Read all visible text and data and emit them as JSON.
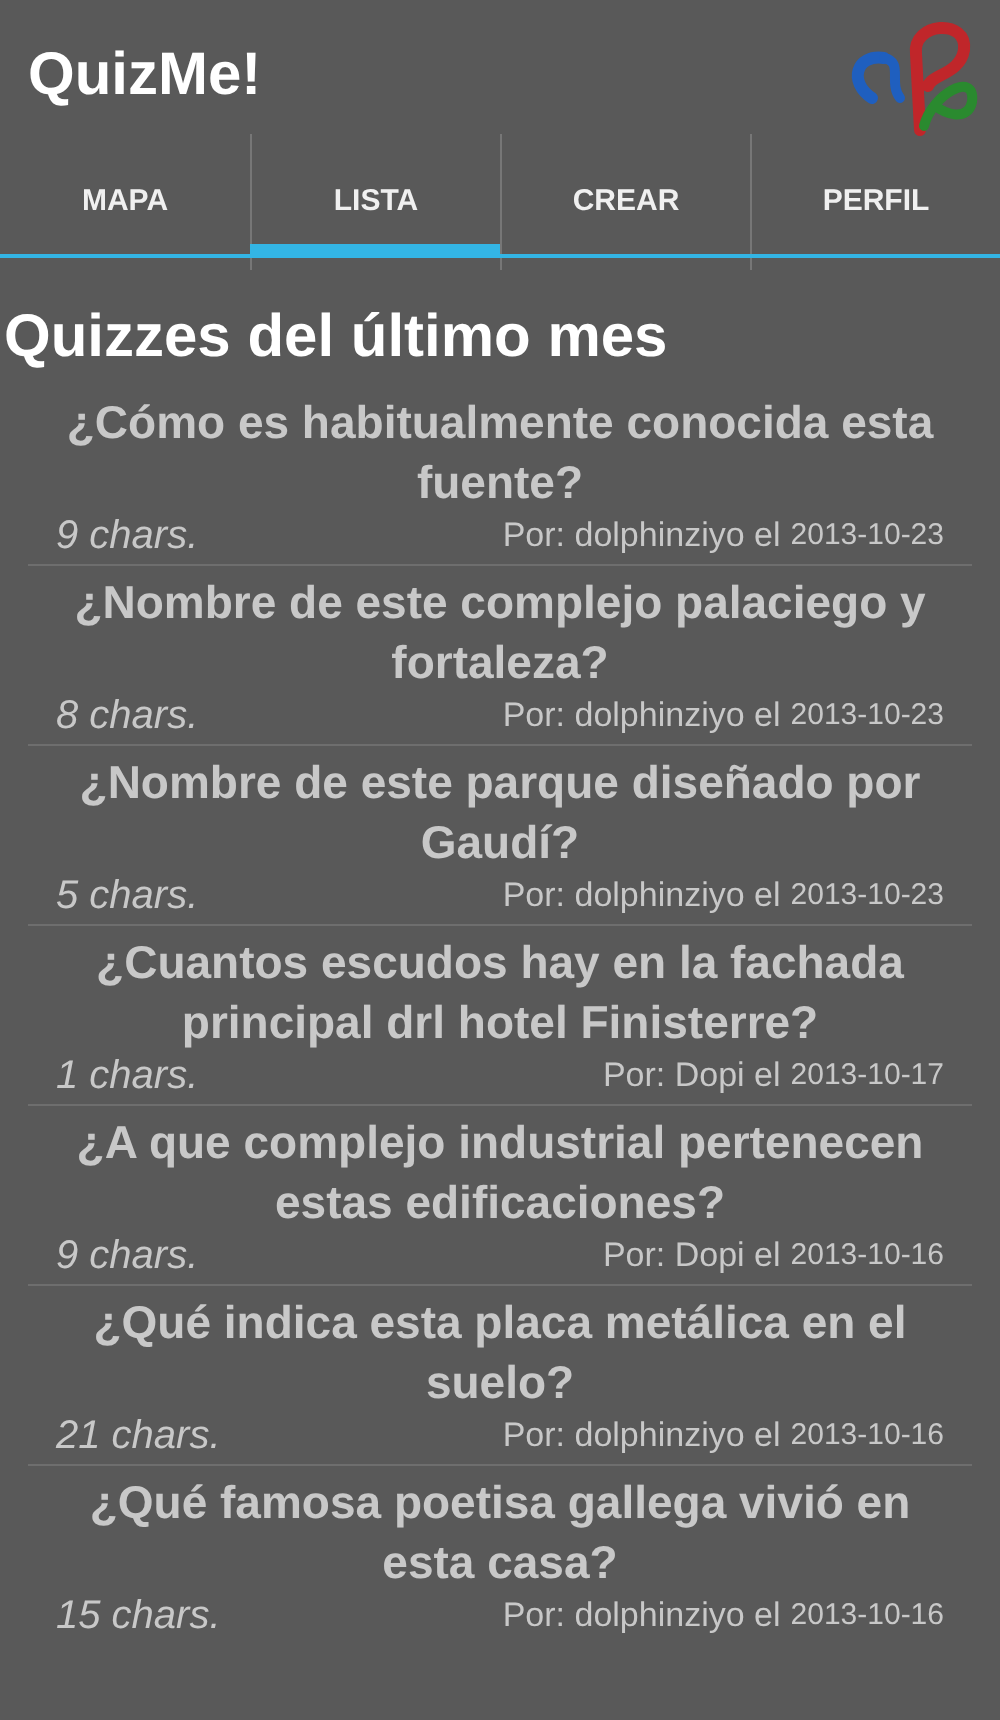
{
  "app_bar": {
    "title": "QuizMe!"
  },
  "tabs": [
    {
      "label": "MAPA",
      "selected": false
    },
    {
      "label": "LISTA",
      "selected": true
    },
    {
      "label": "CREAR",
      "selected": false
    },
    {
      "label": "PERFIL",
      "selected": false
    }
  ],
  "heading": "Quizzes del último mes",
  "quizzes": [
    {
      "question": "¿Cómo es habitualmente conocida esta fuente?",
      "chars": "9 chars.",
      "author": "Por: dolphinziyo el",
      "date": "2013-10-23"
    },
    {
      "question": "¿Nombre de este complejo palaciego y fortaleza?",
      "chars": "8 chars.",
      "author": "Por: dolphinziyo el",
      "date": "2013-10-23"
    },
    {
      "question": "¿Nombre de este parque diseñado por Gaudí?",
      "chars": "5 chars.",
      "author": "Por: dolphinziyo el",
      "date": "2013-10-23"
    },
    {
      "question": "¿Cuantos escudos hay en la fachada principal drl hotel Finisterre?",
      "chars": "1 chars.",
      "author": "Por: Dopi el",
      "date": "2013-10-17"
    },
    {
      "question": "¿A que complejo industrial pertenecen estas edificaciones?",
      "chars": "9 chars.",
      "author": "Por: Dopi el",
      "date": "2013-10-16"
    },
    {
      "question": "¿Qué indica esta placa metálica en el suelo?",
      "chars": "21 chars.",
      "author": "Por: dolphinziyo el",
      "date": "2013-10-16"
    },
    {
      "question": "¿Qué famosa poetisa gallega vivió en esta casa?",
      "chars": "15 chars.",
      "author": "Por: dolphinziyo el",
      "date": "2013-10-16"
    }
  ]
}
